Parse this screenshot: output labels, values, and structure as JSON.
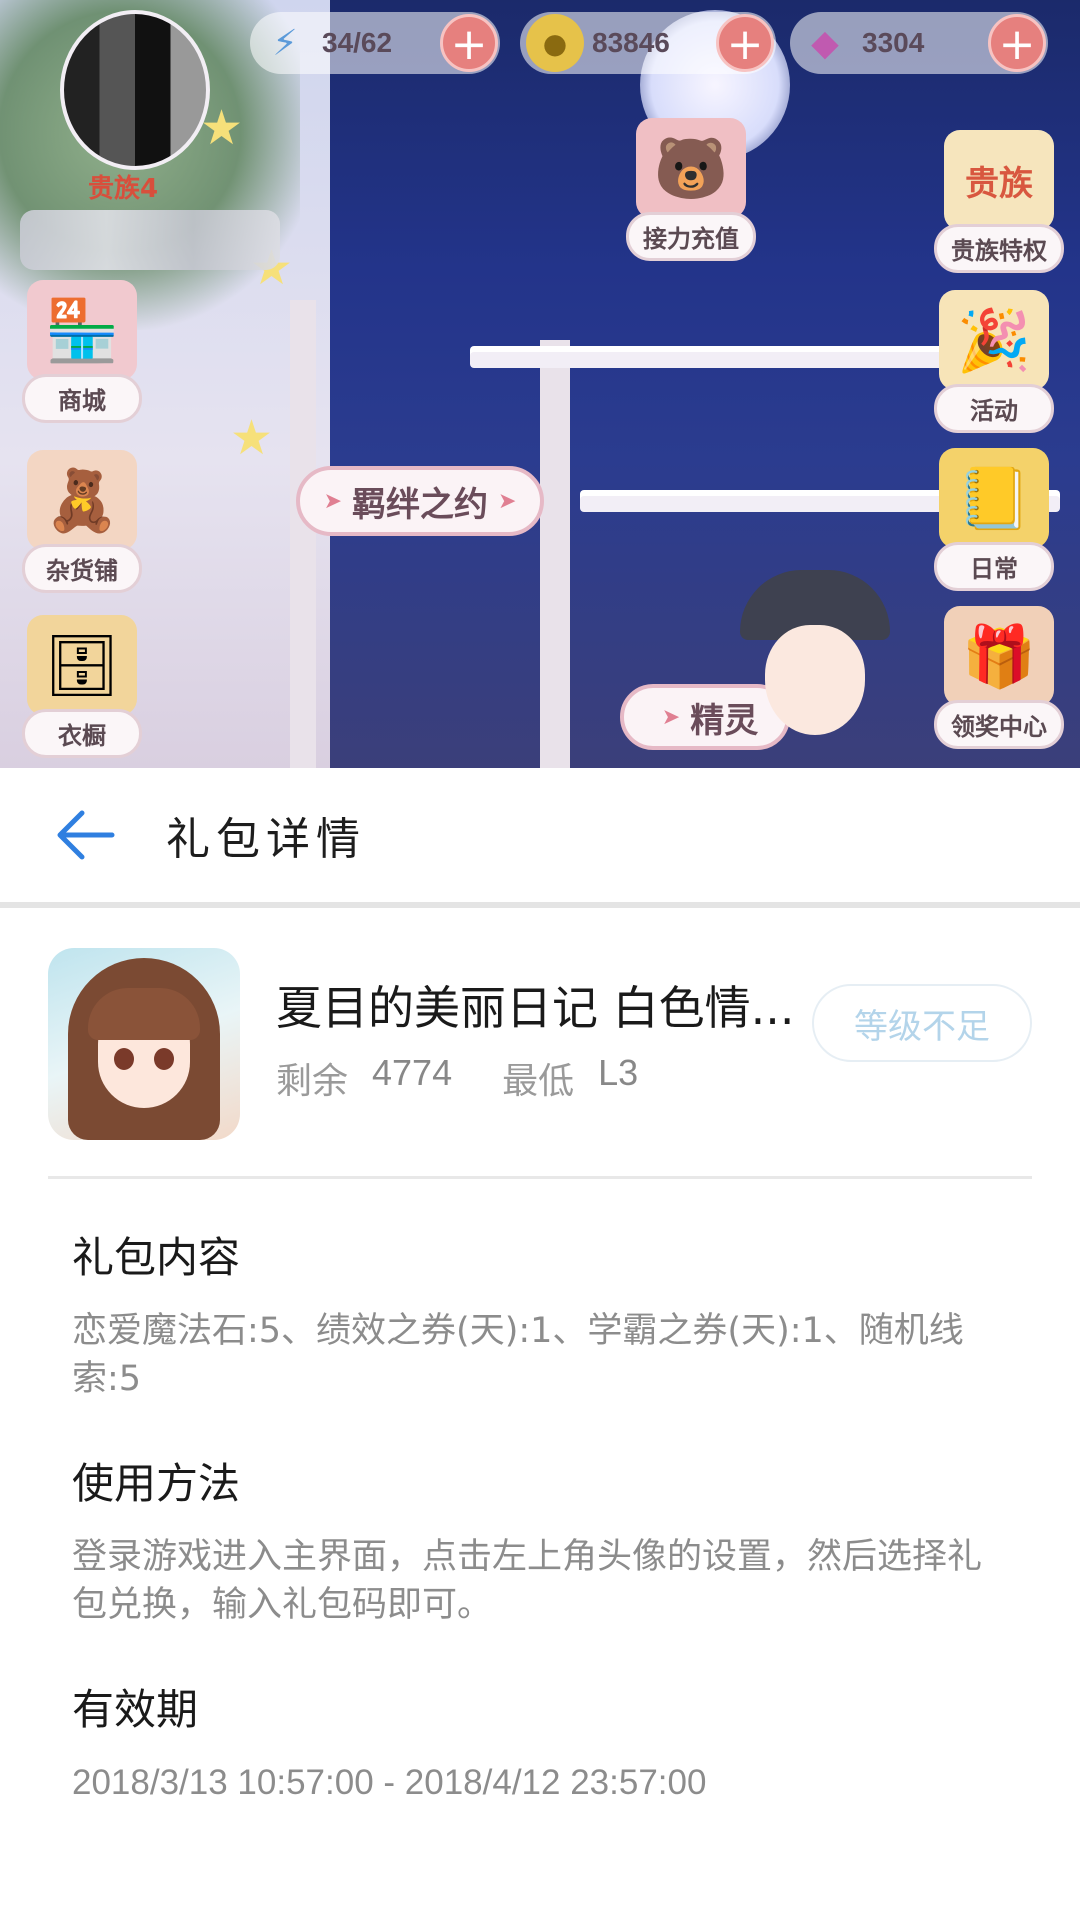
{
  "game": {
    "energy": "34/62",
    "gold": "83846",
    "gems": "3304",
    "rank": "贵族4",
    "buttons": {
      "shop": "商城",
      "grocery": "杂货铺",
      "wardrobe": "衣橱",
      "relay_recharge": "接力充值",
      "noble_privilege": "贵族特权",
      "noble_icon_text": "贵族",
      "activity": "活动",
      "daily": "日常",
      "reward_center": "领奖中心"
    },
    "banners": {
      "bond": "羁绊之约",
      "spirit": "精灵"
    }
  },
  "header": {
    "title": "礼包详情"
  },
  "gift": {
    "name": "夏目的美丽日记 白色情...",
    "remaining_label": "剩余",
    "remaining_value": "4774",
    "min_label": "最低",
    "min_value": "L3",
    "action_label": "等级不足"
  },
  "sections": {
    "contents_title": "礼包内容",
    "contents_body": "恋爱魔法石:5、绩效之券(天):1、学霸之券(天):1、随机线索:5",
    "usage_title": "使用方法",
    "usage_body": "登录游戏进入主界面，点击左上角头像的设置，然后选择礼包兑换，输入礼包码即可。",
    "validity_title": "有效期",
    "validity_body": "2018/3/13 10:57:00 - 2018/4/12 23:57:00"
  },
  "colors": {
    "accent_blue": "#2f7fe0",
    "disabled_button_text": "#b3d4ea",
    "plus_button": "#e6807e"
  }
}
